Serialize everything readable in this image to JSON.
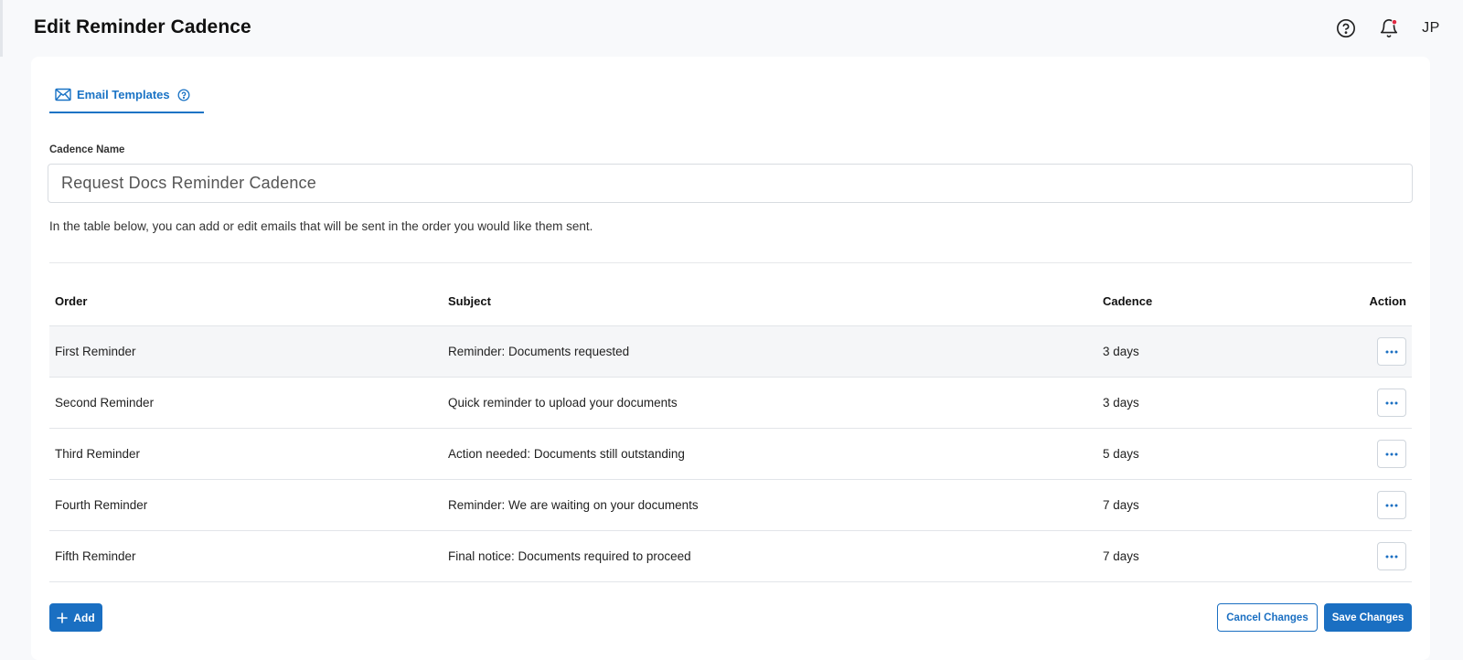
{
  "header": {
    "title": "Edit Reminder Cadence",
    "user_initials": "JP",
    "icons": {
      "help": "help-circle-icon",
      "notifications": "bell-icon",
      "notification_dot_color": "#e02a43"
    }
  },
  "tabs": [
    {
      "label": "Email Templates",
      "icon": "mail-icon",
      "help_icon": "help-circle-icon",
      "active": true
    }
  ],
  "form": {
    "cadence_name_label": "Cadence Name",
    "cadence_name_value": "Request Docs Reminder Cadence",
    "help_text": "In the table below, you can add or edit emails that will be sent in the order you would like them sent."
  },
  "table": {
    "columns": {
      "order": "Order",
      "subject": "Subject",
      "cadence": "Cadence",
      "action": "Action"
    },
    "rows": [
      {
        "order": "First Reminder",
        "subject": "Reminder: Documents requested",
        "cadence": "3 days",
        "action_icon": "more-horizontal-icon"
      },
      {
        "order": "Second Reminder",
        "subject": "Quick reminder to upload your documents",
        "cadence": "3 days",
        "action_icon": "more-horizontal-icon"
      },
      {
        "order": "Third Reminder",
        "subject": "Action needed: Documents still outstanding",
        "cadence": "5 days",
        "action_icon": "more-horizontal-icon"
      },
      {
        "order": "Fourth Reminder",
        "subject": "Reminder: We are waiting on your documents",
        "cadence": "7 days",
        "action_icon": "more-horizontal-icon"
      },
      {
        "order": "Fifth Reminder",
        "subject": "Final notice: Documents required to proceed",
        "cadence": "7 days",
        "action_icon": "more-horizontal-icon"
      }
    ]
  },
  "footer": {
    "add_label": "Add",
    "cancel_label": "Cancel Changes",
    "save_label": "Save Changes"
  },
  "colors": {
    "accent": "#1a6fc2",
    "background": "#f8f9fb",
    "row_highlight": "#f5f6f8"
  }
}
